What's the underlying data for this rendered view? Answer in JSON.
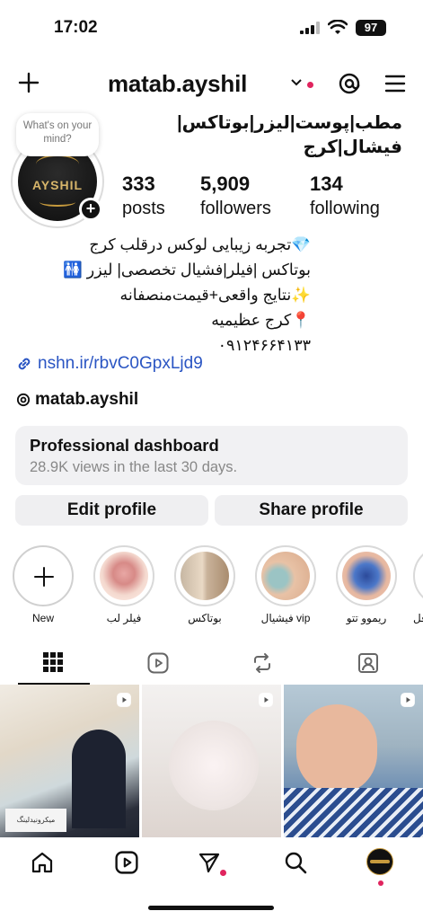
{
  "status": {
    "time": "17:02",
    "battery": "97"
  },
  "header": {
    "username": "matab.ayshil"
  },
  "bubble": {
    "text": "What's on your mind?"
  },
  "avatar": {
    "logo": "AYSHIL"
  },
  "profile": {
    "name": "مطب|پوست|لیزر|بوتاکس|فیشال|کرج",
    "stats": [
      {
        "num": "333",
        "label": "posts"
      },
      {
        "num": "5,909",
        "label": "followers"
      },
      {
        "num": "134",
        "label": "following"
      }
    ],
    "bio": [
      "💎تجربه زیبایی لوکس درقلب کرج",
      "بوتاکس |فیلر|فشیال تخصصی| لیزر 🚻",
      "✨نتایج واقعی+قیمت‌منصفانه",
      "📍کرج عظیمیه",
      "۰۹۱۲۴۶۶۴۱۳۳"
    ],
    "link": "nshn.ir/rbvC0GpxLjd9",
    "threads": "matab.ayshil"
  },
  "dashboard": {
    "title": "Professional dashboard",
    "subtitle": "28.9K views in the last 30 days."
  },
  "buttons": {
    "edit": "Edit profile",
    "share": "Share profile"
  },
  "highlights": [
    {
      "label": "New"
    },
    {
      "label": "فیلر لب"
    },
    {
      "label": "بوتاکس"
    },
    {
      "label": "فیشیال vip"
    },
    {
      "label": "ریموو تتو"
    },
    {
      "label": "فل"
    }
  ],
  "posts": [
    {
      "caption": "میکرونیدلینگ"
    },
    {
      "caption": ""
    },
    {
      "caption": ""
    }
  ],
  "colors": {
    "accent": "#e0245e",
    "link": "#2a55c3",
    "panel": "#f1f1f3"
  }
}
